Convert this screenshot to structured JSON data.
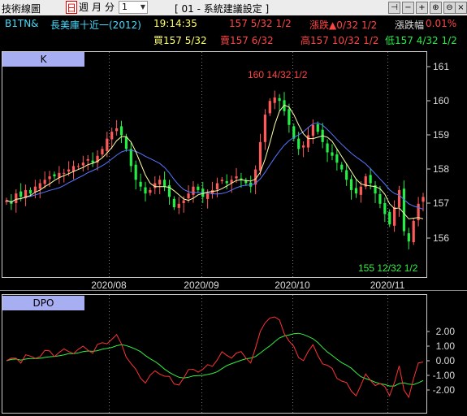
{
  "toolbar": {
    "app_title": "技術線圖",
    "periods": [
      "日",
      "週",
      "月",
      "分"
    ],
    "active_period": "日",
    "interval_value": "1",
    "window_title": "[ 01 - 系統建議設定 ]"
  },
  "quote": {
    "symbol": "B1TN&",
    "name": "長美庫十近一(2012)",
    "time": "19:14:35",
    "last": "157 5/32 1/2",
    "change": "漲跌▲0/32 1/2",
    "change_pct_label": "漲跌幅",
    "change_pct": "0.01%",
    "bid": "買157 5/32",
    "ask": "賣157 6/32",
    "high": "高157 10/32 1/2",
    "low": "低157 4/32 1/2"
  },
  "colors": {
    "up": "#ff5a5a",
    "down": "#22ee44",
    "ma_fast": "#ffffaa",
    "ma_slow": "#5577ff",
    "dpo": "#ff3333",
    "dpo_signal": "#33ee44",
    "panel_label_bg": "#a8aef2",
    "price_text": "#ff4444",
    "change_text": "#ff4444",
    "time_text": "#ffff66",
    "name_text": "#44ddff"
  },
  "k_panel": {
    "label": "K",
    "y_ticks": [
      "161",
      "160",
      "159",
      "158",
      "157",
      "156"
    ],
    "high_annotation": "160 14/32 1/2",
    "low_annotation": "155 12/32 1/2",
    "x_labels": [
      "2020/08",
      "2020/09",
      "2020/10",
      "2020/11"
    ]
  },
  "dpo_panel": {
    "label": "DPO",
    "y_ticks": [
      "2.00",
      "1.00",
      "0.00",
      "-1.00",
      "-2.00"
    ]
  }
}
